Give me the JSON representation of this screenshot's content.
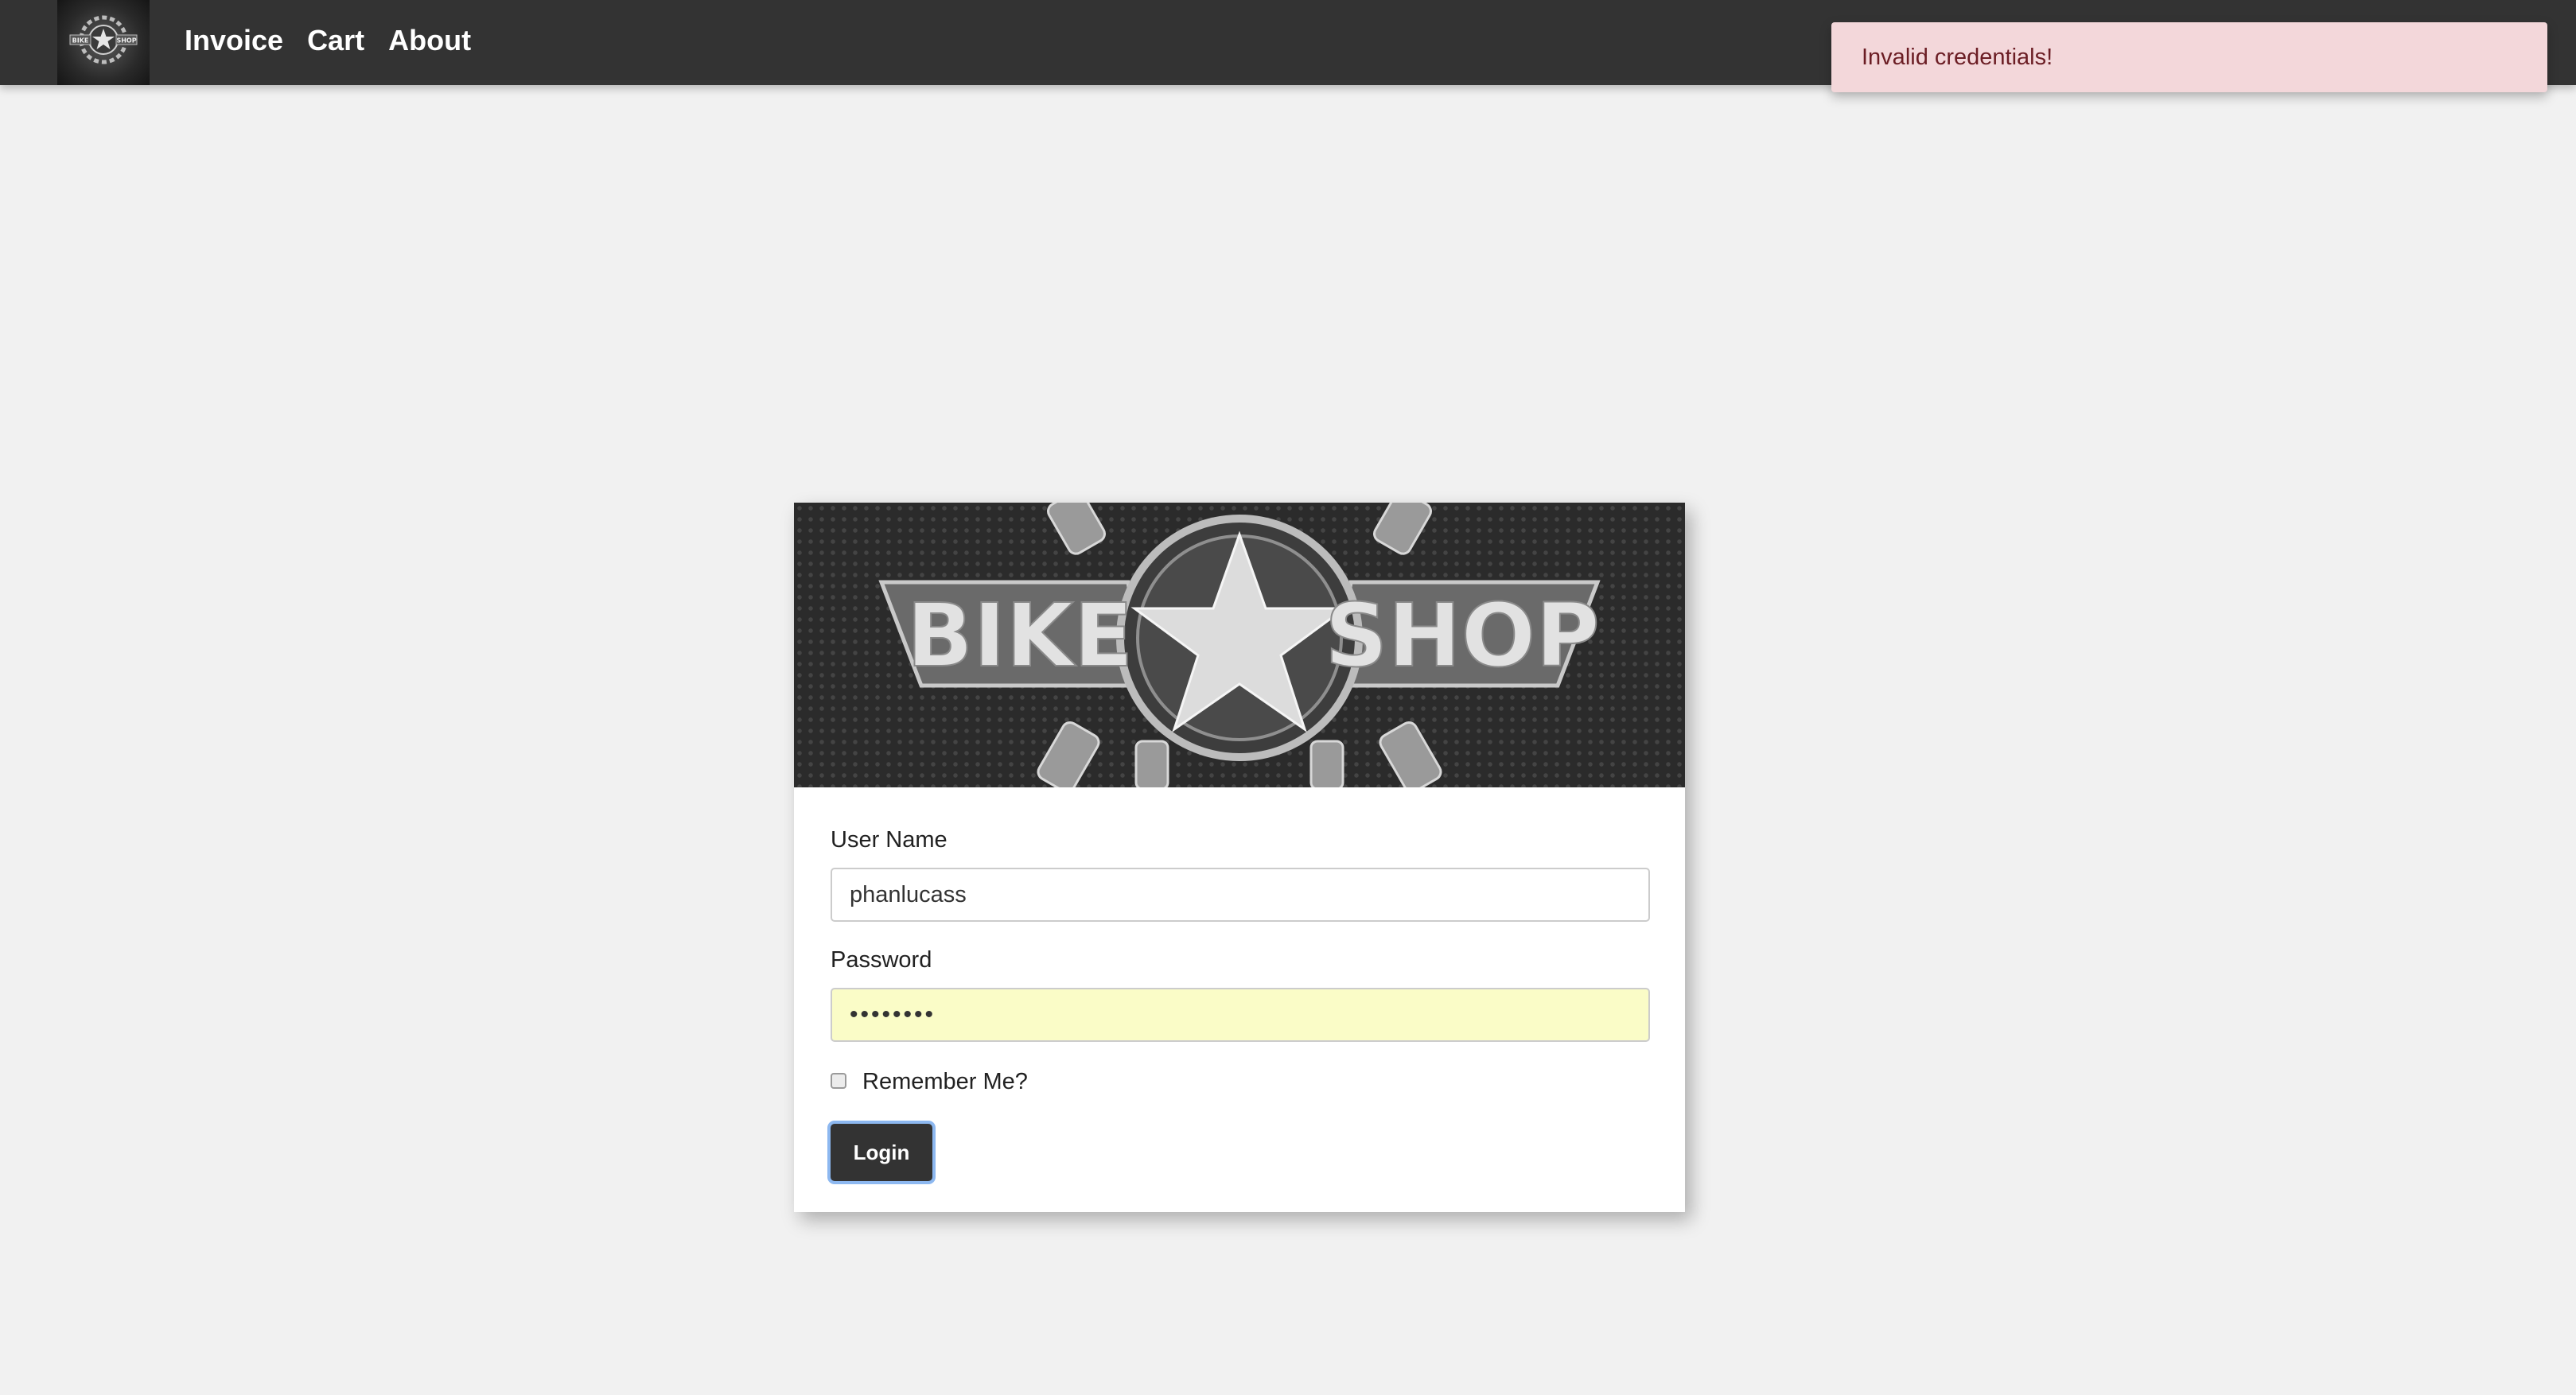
{
  "navbar": {
    "logo_text": "BIKE SHOP",
    "links": [
      {
        "label": "Invoice"
      },
      {
        "label": "Cart"
      },
      {
        "label": "About"
      }
    ]
  },
  "toast": {
    "message": "Invalid credentials!"
  },
  "login": {
    "banner": {
      "left_word": "BIKE",
      "right_word": "SHOP"
    },
    "username_label": "User Name",
    "username_value": "phanlucass",
    "password_label": "Password",
    "password_value": "••••••••",
    "remember_label": "Remember Me?",
    "remember_checked": false,
    "submit_label": "Login"
  },
  "colors": {
    "navbar_bg": "#333333",
    "page_bg": "#f1f1f1",
    "toast_bg": "#f3d7da",
    "toast_text": "#6b1d24",
    "autofill_bg": "#fafcc7",
    "button_bg": "#333333",
    "focus_ring": "#8db8f0"
  }
}
